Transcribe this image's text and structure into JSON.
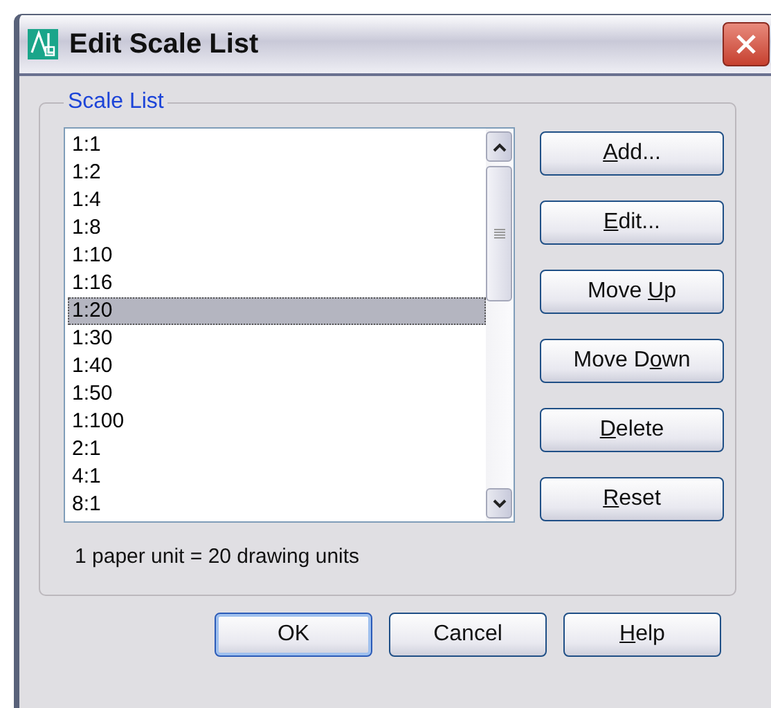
{
  "window": {
    "title": "Edit Scale List"
  },
  "group": {
    "label": "Scale List"
  },
  "scales": [
    {
      "label": "1:1",
      "selected": false
    },
    {
      "label": "1:2",
      "selected": false
    },
    {
      "label": "1:4",
      "selected": false
    },
    {
      "label": "1:8",
      "selected": false
    },
    {
      "label": "1:10",
      "selected": false
    },
    {
      "label": "1:16",
      "selected": false
    },
    {
      "label": "1:20",
      "selected": true
    },
    {
      "label": "1:30",
      "selected": false
    },
    {
      "label": "1:40",
      "selected": false
    },
    {
      "label": "1:50",
      "selected": false
    },
    {
      "label": "1:100",
      "selected": false
    },
    {
      "label": "2:1",
      "selected": false
    },
    {
      "label": "4:1",
      "selected": false
    },
    {
      "label": "8:1",
      "selected": false
    }
  ],
  "side_buttons": [
    {
      "key": "A",
      "after": "dd..."
    },
    {
      "key": "E",
      "after": "dit..."
    },
    {
      "before": "Move ",
      "key": "U",
      "after": "p"
    },
    {
      "before": "Move D",
      "key": "o",
      "after": "wn"
    },
    {
      "key": "D",
      "after": "elete"
    },
    {
      "key": "R",
      "after": "eset"
    }
  ],
  "ratio_text": "1 paper unit = 20 drawing units",
  "dialog_buttons": [
    {
      "before": "OK",
      "default": true
    },
    {
      "before": "Cancel",
      "default": false
    },
    {
      "key": "H",
      "after": "elp",
      "default": false
    }
  ]
}
